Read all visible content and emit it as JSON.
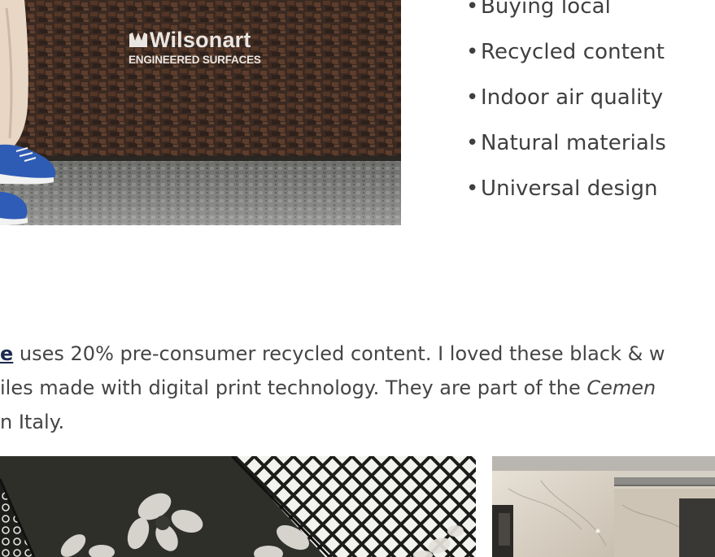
{
  "top_photo": {
    "logo_text": "Wilsonart",
    "logo_subtext": "ENGINEERED SURFACES"
  },
  "bullets": [
    "Buying local",
    "Recycled content",
    "Indoor air quality",
    "Natural materials",
    "Universal design"
  ],
  "bullet_glyph": "•",
  "paragraph": {
    "line1_link": "e",
    "line1_text": " uses 20% pre-consumer recycled content. I loved these black & w",
    "line2_text": "iles made with digital print technology. They are part of the ",
    "line2_em": "Cemen",
    "line3_text": "n Italy."
  },
  "colors": {
    "text": "#454545",
    "link": "#1d2a4f"
  }
}
